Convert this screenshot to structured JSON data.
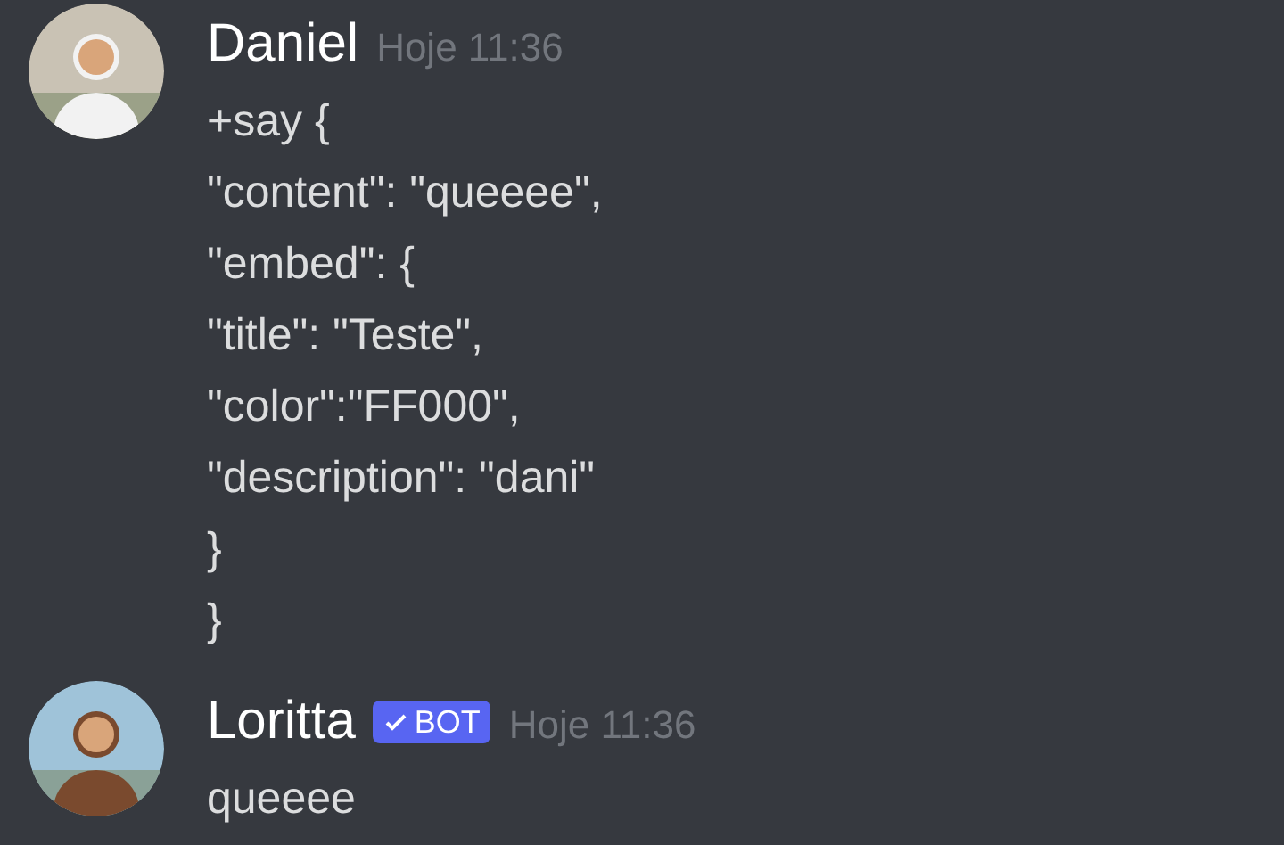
{
  "messages": [
    {
      "author": "Daniel",
      "bot": false,
      "timestamp": "Hoje 11:36",
      "content": "+say {\n\"content\": \"queeee\",\n\"embed\": {\n\"title\": \"Teste\",\n\"color\":\"FF000\",\n\"description\": \"dani\"\n}\n}"
    },
    {
      "author": "Loritta",
      "bot": true,
      "badge": "BOT",
      "timestamp": "Hoje 11:36",
      "content": "queeee"
    }
  ]
}
